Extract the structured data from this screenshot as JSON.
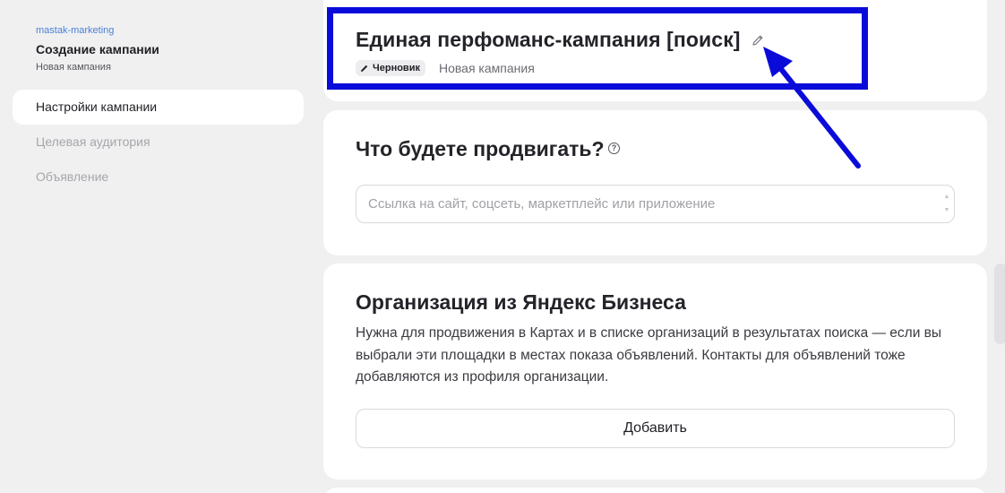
{
  "sidebar": {
    "account": "mastak-marketing",
    "title": "Создание кампании",
    "subtitle": "Новая кампания",
    "items": [
      {
        "label": "Настройки кампании",
        "active": true
      },
      {
        "label": "Целевая аудитория",
        "active": false
      },
      {
        "label": "Объявление",
        "active": false
      }
    ]
  },
  "campaign": {
    "title": "Единая перфоманс-кампания [поиск]",
    "badge": "Черновик",
    "status": "Новая кампания",
    "edit_icon": "pencil-icon"
  },
  "promote": {
    "heading": "Что будете продвигать?",
    "help_icon": "question-icon",
    "help_glyph": "?",
    "input_placeholder": "Ссылка на сайт, соцсеть, маркетплейс или приложение",
    "input_value": ""
  },
  "organization": {
    "heading": "Организация из Яндекс Бизнеса",
    "description": "Нужна для продвижения в Картах и в списке организаций в результатах поиска — если вы выбрали эти площадки в местах показа объявлений. Контакты для объявлений тоже добавляются из профиля организации.",
    "add_label": "Добавить"
  },
  "annotation": {
    "highlight_color": "#0b0bd9"
  }
}
